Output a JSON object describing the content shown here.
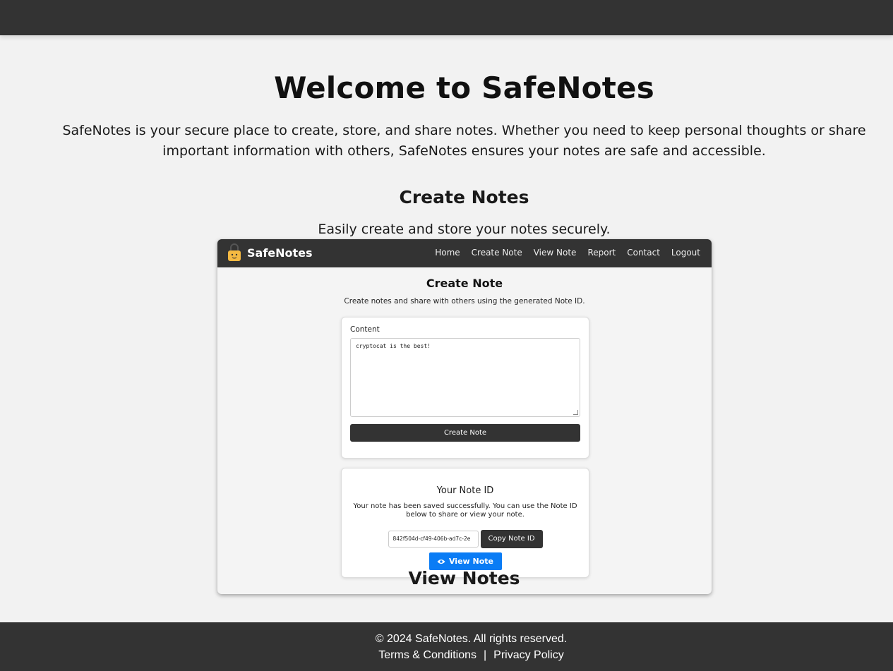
{
  "hero": {
    "title": "Welcome to SafeNotes",
    "intro": "SafeNotes is your secure place to create, store, and share notes. Whether you need to keep personal thoughts or share important information with others, SafeNotes ensures your notes are safe and accessible."
  },
  "sections": {
    "create": {
      "title": "Create Notes",
      "text": "Easily create and store your notes securely."
    },
    "view": {
      "title": "View Notes"
    }
  },
  "screenshot": {
    "brand": "SafeNotes",
    "nav": [
      "Home",
      "Create Note",
      "View Note",
      "Report",
      "Contact",
      "Logout"
    ],
    "heading": "Create Note",
    "subheading": "Create notes and share with others using the generated Note ID.",
    "content_label": "Content",
    "content_value": "cryptocat is the best!",
    "create_button": "Create Note",
    "note_id_title": "Your Note ID",
    "note_id_text": "Your note has been saved successfully. You can use the Note ID below to share or view your note.",
    "note_id_value": "842f504d-cf49-406b-ad7c-2e",
    "copy_button": "Copy Note ID",
    "view_button": "View Note",
    "colors": {
      "nav": "#333333",
      "primary": "#0a7cf5"
    },
    "icons": [
      "lock-icon",
      "eye-icon"
    ]
  },
  "footer": {
    "copyright": "© 2024 SafeNotes. All rights reserved.",
    "terms": "Terms & Conditions",
    "separator": "|",
    "privacy": "Privacy Policy"
  }
}
